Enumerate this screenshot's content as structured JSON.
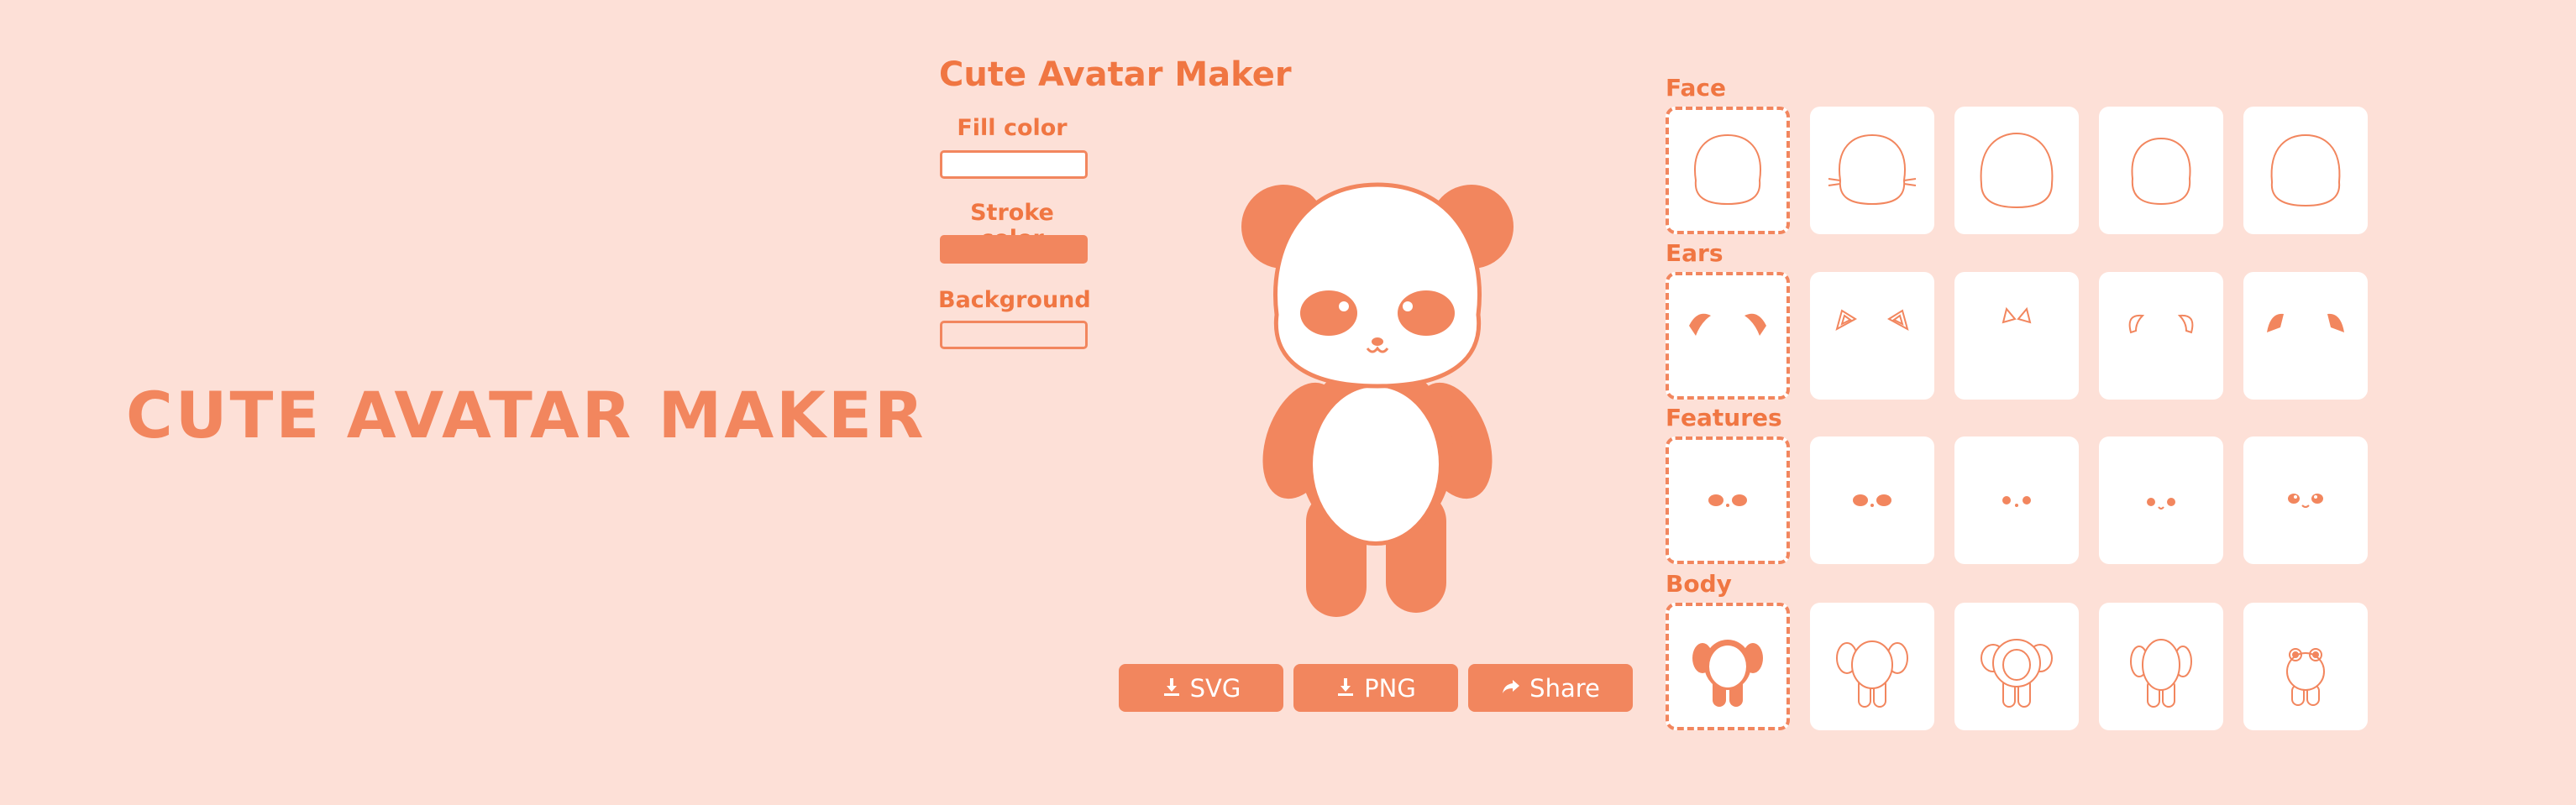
{
  "hero": {
    "title": "CUTE AVATAR MAKER"
  },
  "app": {
    "title": "Cute Avatar Maker"
  },
  "controls": {
    "fill_label": "Fill color",
    "stroke_label": "Stroke color",
    "background_label": "Background",
    "fill_value": "#ffffff",
    "stroke_value": "#f2865e",
    "background_value": "#fde0d7"
  },
  "actions": {
    "svg_label": "SVG",
    "png_label": "PNG",
    "share_label": "Share"
  },
  "sections": {
    "face_label": "Face",
    "ears_label": "Ears",
    "features_label": "Features",
    "body_label": "Body"
  },
  "colors": {
    "accent": "#f2865e",
    "background": "#fde0d7",
    "tile": "#ffffff"
  },
  "icons": [
    "download-icon",
    "share-icon"
  ]
}
